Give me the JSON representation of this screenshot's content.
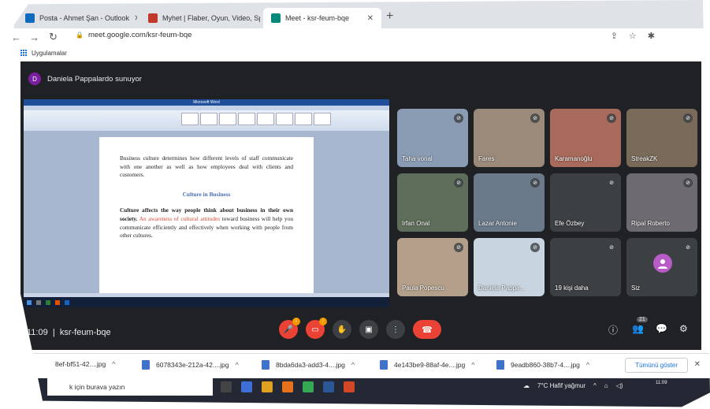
{
  "browser": {
    "tabs": [
      {
        "label": "Posta - Ahmet Şan - Outlook",
        "icon_color": "#0f6cbd"
      },
      {
        "label": "Myhet | Flaber, Oyun, Video, Spor",
        "icon_color": "#c0392b"
      },
      {
        "label": "Meet - ksr-feum-bqe",
        "icon_color": "#00897b"
      }
    ],
    "url": "meet.google.com/ksr-feum-bqe",
    "bookmark_label": "Uygulamalar"
  },
  "meet": {
    "presenter_initial": "D",
    "presenter_text": "Daniela Pappalardo sunuyor",
    "meeting_time": "11:09",
    "meeting_code": "ksr-feum-bqe",
    "people_count": "21",
    "mic_badge": "!",
    "cam_badge": "!",
    "participants": [
      {
        "name": "Taha vonal",
        "bg": "#8a9cb4"
      },
      {
        "name": "Fares",
        "bg": "#9b8a7a"
      },
      {
        "name": "Karamanoğlu",
        "bg": "#a86a5a"
      },
      {
        "name": "StreakZK",
        "bg": "#7a6a5a"
      },
      {
        "name": "Irfan Onal",
        "bg": "#5e6e5a"
      },
      {
        "name": "Lazar Antonie",
        "bg": "#6a7a8a"
      },
      {
        "name": "Efe Özbey",
        "bg": "#3c4043"
      },
      {
        "name": "Ripal Roberto",
        "bg": "#6d6a70"
      },
      {
        "name": "Paula Popescu",
        "bg": "#b4a08a"
      },
      {
        "name": "Daniela Pappa...",
        "bg": "#c8d4e0"
      },
      {
        "name": "19 kişi daha",
        "bg": "#3c4043"
      },
      {
        "name": "Siz",
        "bg": "#3c4043"
      }
    ]
  },
  "shared_doc": {
    "window_title": "Microsoft Word",
    "para1": "Business culture determines how different levels of staff communicate with one another as well as how employees deal with clients and customers.",
    "heading": "Culture in Business",
    "para2_bold": "Culture affects the way people think about business in their own society.",
    "para2_red": "An awareness of cultural attitudes",
    "para2_rest": "toward business will help you communicate efficiently and effectively when working with people from other cultures."
  },
  "downloads": {
    "items": [
      "8ef-bf51-42....jpg",
      "6078343e-212a-42....jpg",
      "8bda6da3-add3-4....jpg",
      "4e143be9-88af-4e....jpg",
      "9eadb860-38b7-4....jpg"
    ],
    "show_all": "Tümünü göster"
  },
  "taskbar": {
    "search_placeholder": "k için burava yazın",
    "weather": "7°C  Hafif yağmur",
    "time": "11:09"
  }
}
